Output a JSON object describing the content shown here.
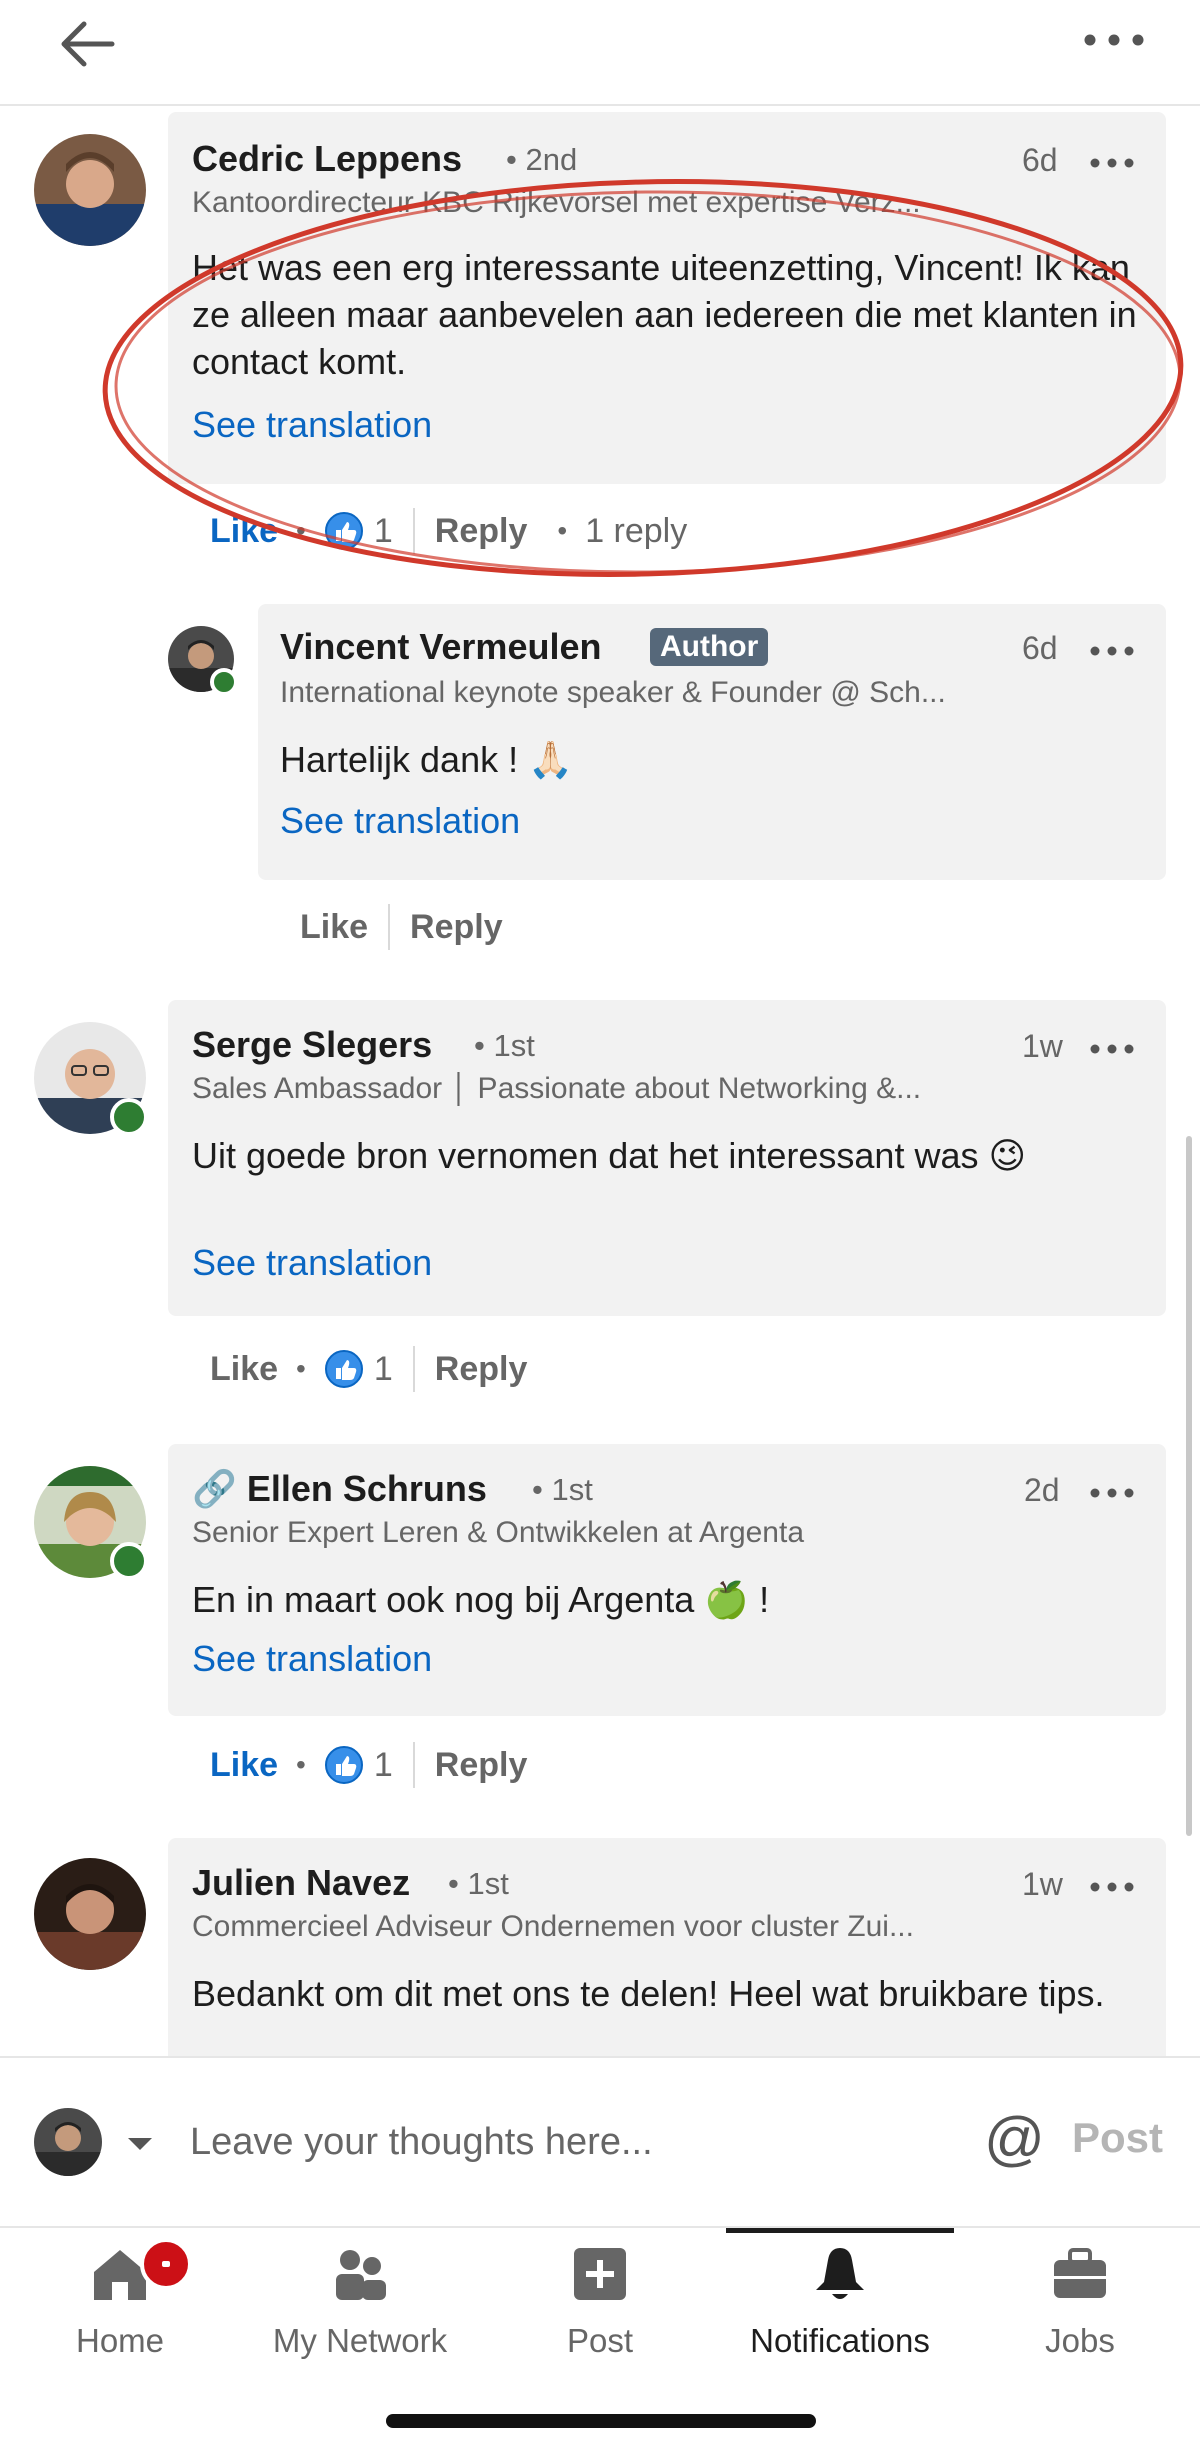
{
  "topbar": {
    "back_icon": "arrow-left-icon",
    "more_icon": "more-horizontal-icon"
  },
  "comments": [
    {
      "name": "Cedric Leppens",
      "degree": "• 2nd",
      "time": "6d",
      "headline": "Kantoordirecteur KBC Rijkevorsel met expertise Verz...",
      "text": "Het was een erg interessante uiteenzetting, Vincent! Ik kan ze alleen maar aanbevelen aan iedereen die met klanten in contact komt.",
      "see_translation": "See translation",
      "like": "Like",
      "like_count": "1",
      "reply": "Reply",
      "reply_count": "1 reply",
      "highlight_color": "#d0392b"
    },
    {
      "name": "Vincent Vermeulen",
      "badge": "Author",
      "time": "6d",
      "headline": "International keynote speaker & Founder @ Sch...",
      "text": "Hartelijk dank ! 🙏🏻",
      "see_translation": "See translation",
      "like": "Like",
      "reply": "Reply"
    },
    {
      "name": "Serge Slegers",
      "degree": "• 1st",
      "time": "1w",
      "headline": "Sales Ambassador  │  Passionate about Networking &...",
      "text": "Uit goede bron vernomen dat het interessant was 😉",
      "see_translation": "See translation",
      "like": "Like",
      "like_count": "1",
      "reply": "Reply"
    },
    {
      "name": "🔗 Ellen Schruns",
      "degree": "• 1st",
      "time": "2d",
      "headline": "Senior Expert Leren & Ontwikkelen at Argenta",
      "text": "En in maart ook nog bij Argenta 🍏 !",
      "see_translation": "See translation",
      "like": "Like",
      "like_count": "1",
      "reply": "Reply"
    },
    {
      "name": "Julien Navez",
      "degree": "• 1st",
      "time": "1w",
      "headline": "Commercieel Adviseur Ondernemen voor cluster Zui...",
      "text": "Bedankt om dit met ons te delen! Heel wat bruikbare tips."
    }
  ],
  "composer": {
    "placeholder": "Leave your thoughts here...",
    "at_symbol": "@",
    "post_label": "Post"
  },
  "nav": [
    {
      "label": "Home",
      "icon": "home-icon"
    },
    {
      "label": "My Network",
      "icon": "network-icon"
    },
    {
      "label": "Post",
      "icon": "post-plus-icon"
    },
    {
      "label": "Notifications",
      "icon": "bell-icon"
    },
    {
      "label": "Jobs",
      "icon": "briefcase-icon"
    }
  ],
  "colors": {
    "link_blue": "#0a66c2",
    "bubble_bg": "#f2f2f2",
    "author_badge": "#56687a",
    "notification_badge": "#cc1016",
    "online_green": "#2e7d32"
  }
}
